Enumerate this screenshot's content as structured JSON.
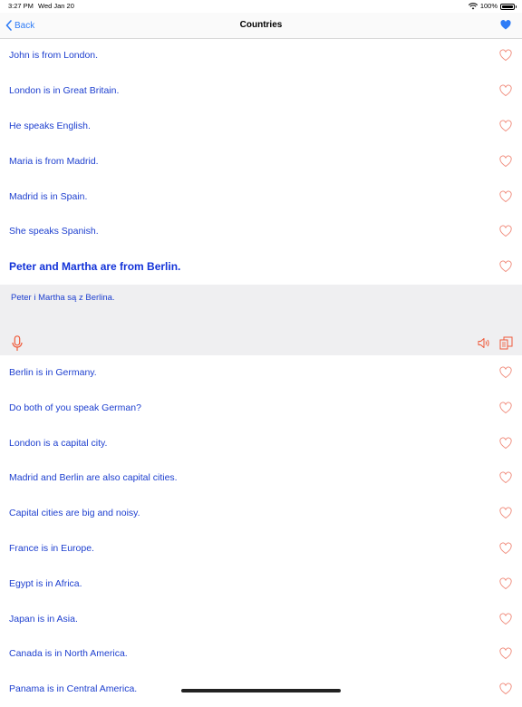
{
  "status_bar": {
    "time": "3:27 PM",
    "date": "Wed Jan 20",
    "battery": "100%"
  },
  "nav": {
    "back_label": "Back",
    "title": "Countries"
  },
  "rows_before": [
    {
      "text": "John is from London."
    },
    {
      "text": "London is in Great Britain."
    },
    {
      "text": "He speaks English."
    },
    {
      "text": "Maria is from Madrid."
    },
    {
      "text": "Madrid is in Spain."
    },
    {
      "text": "She speaks Spanish."
    }
  ],
  "active_row": {
    "text": "Peter and Martha are from Berlin.",
    "translation": "Peter i Martha są z Berlina."
  },
  "rows_after": [
    {
      "text": "Berlin is in Germany."
    },
    {
      "text": "Do both of you speak German?"
    },
    {
      "text": "London is a capital city."
    },
    {
      "text": "Madrid and Berlin are also capital cities."
    },
    {
      "text": "Capital cities are big and noisy."
    },
    {
      "text": "France is in Europe."
    },
    {
      "text": "Egypt is in Africa."
    },
    {
      "text": "Japan is in Asia."
    },
    {
      "text": "Canada is in North America."
    },
    {
      "text": "Panama is in Central America."
    }
  ],
  "colors": {
    "accent": "#2f7cf6",
    "text_blue": "#1d3fcf",
    "heart": "#f08a7a",
    "tool_icon": "#ef5a3a"
  },
  "icons": {
    "nav_favorite": "heart-filled-icon",
    "row_favorite": "heart-outline-icon",
    "record": "microphone-icon",
    "play": "speaker-icon",
    "copy": "copy-icon"
  }
}
